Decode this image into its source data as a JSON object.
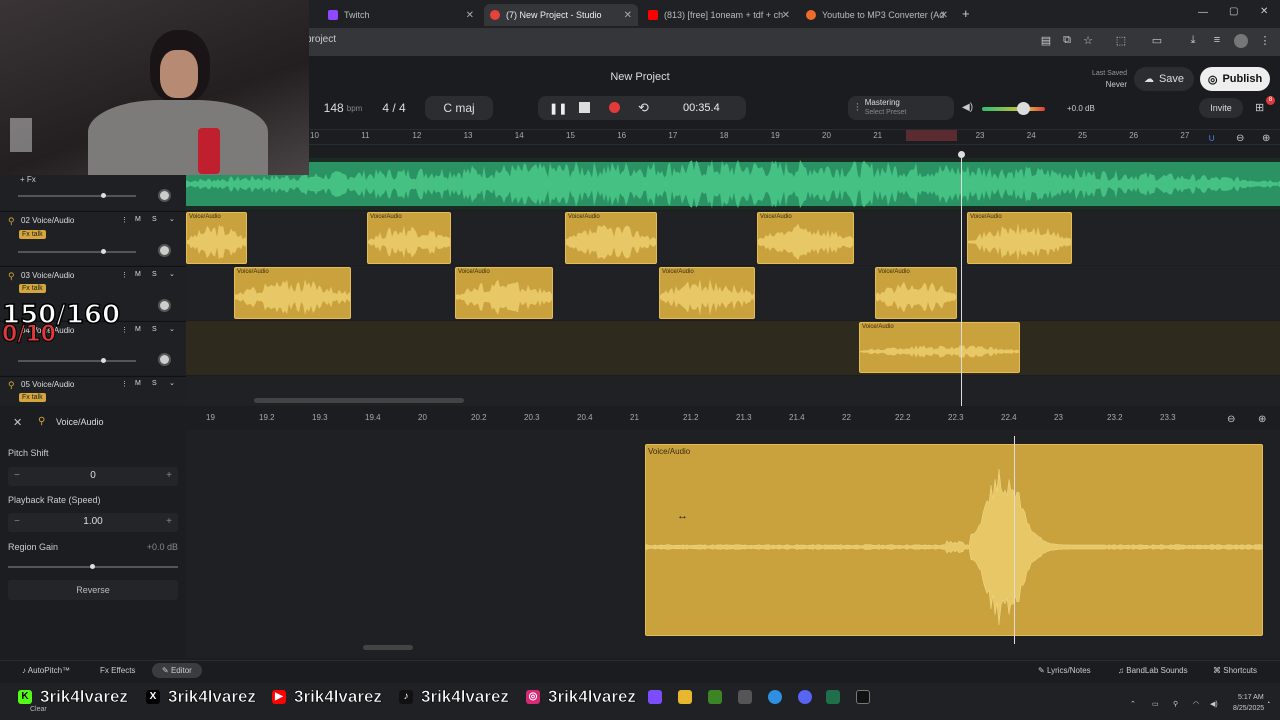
{
  "browser": {
    "tabs": [
      {
        "title": "Twitch",
        "color": "#9146ff"
      },
      {
        "title": "(7) New Project - Studio",
        "color": "#e8413a"
      },
      {
        "title": "(813) [free] 1oneam + tdf + ch",
        "color": "#ff0000"
      },
      {
        "title": "Youtube to MP3 Converter (Ad",
        "color": "#f06a2a"
      }
    ],
    "url": "project",
    "new_tab_label": "+"
  },
  "app": {
    "project_title": "New Project",
    "bpm": "148",
    "bpm_unit": "bpm",
    "time_signature": "4 / 4",
    "key": "C maj",
    "time": "00:35.4",
    "mastering_label": "Mastering",
    "mastering_preset": "Select Preset",
    "volume_db": "+0.0 dB",
    "last_saved_label": "Last Saved",
    "last_saved_value": "Never",
    "save_label": "Save",
    "publish_label": "Publish",
    "invite_label": "Invite",
    "notification_count": "8"
  },
  "ruler": [
    "10",
    "11",
    "12",
    "13",
    "14",
    "15",
    "16",
    "17",
    "18",
    "19",
    "20",
    "21",
    "22",
    "23",
    "24",
    "25",
    "26",
    "27"
  ],
  "tracks": [
    {
      "num": "",
      "name": "",
      "fx": "+ Fx"
    },
    {
      "num": "02",
      "name": "Voice/Audio",
      "fx": "Fx talk"
    },
    {
      "num": "03",
      "name": "Voice/Audio",
      "fx": "Fx talk"
    },
    {
      "num": "04",
      "name": "Voice/Audio",
      "fx": "Fx talk"
    },
    {
      "num": "05",
      "name": "Voice/Audio",
      "fx": "Fx talk"
    }
  ],
  "track_names": {
    "t2": "02  Voice/Audio",
    "t3": "03  Voice/Audio",
    "t4": "04  Voice/Audio",
    "t5": "05  Voice/Audio"
  },
  "clip_label": "Voice/Audio",
  "ms": {
    "m": "M",
    "s": "S"
  },
  "editor": {
    "title": "Voice/Audio",
    "pitch_label": "Pitch Shift",
    "pitch_value": "0",
    "rate_label": "Playback Rate (Speed)",
    "rate_value": "1.00",
    "gain_label": "Region Gain",
    "gain_value": "+0.0 dB",
    "reverse_label": "Reverse",
    "ruler": [
      "19",
      "19.2",
      "19.3",
      "19.4",
      "20",
      "20.2",
      "20.3",
      "20.4",
      "21",
      "21.2",
      "21.3",
      "21.4",
      "22",
      "22.2",
      "22.3",
      "22.4",
      "23",
      "23.2",
      "23.3"
    ],
    "clip_label": "Voice/Audio"
  },
  "bottom": {
    "autopitch": "AutoPitch™",
    "effects": "Effects",
    "editor": "Editor",
    "lyrics": "Lyrics/Notes",
    "sounds": "BandLab Sounds",
    "shortcuts": "Shortcuts"
  },
  "overlay": {
    "counter": "150/160",
    "counter2": "0/10",
    "handle": "3rik4lvarez"
  },
  "taskbar": {
    "weather": "Clear",
    "time": "5:17 AM",
    "date": "8/25/2025"
  }
}
